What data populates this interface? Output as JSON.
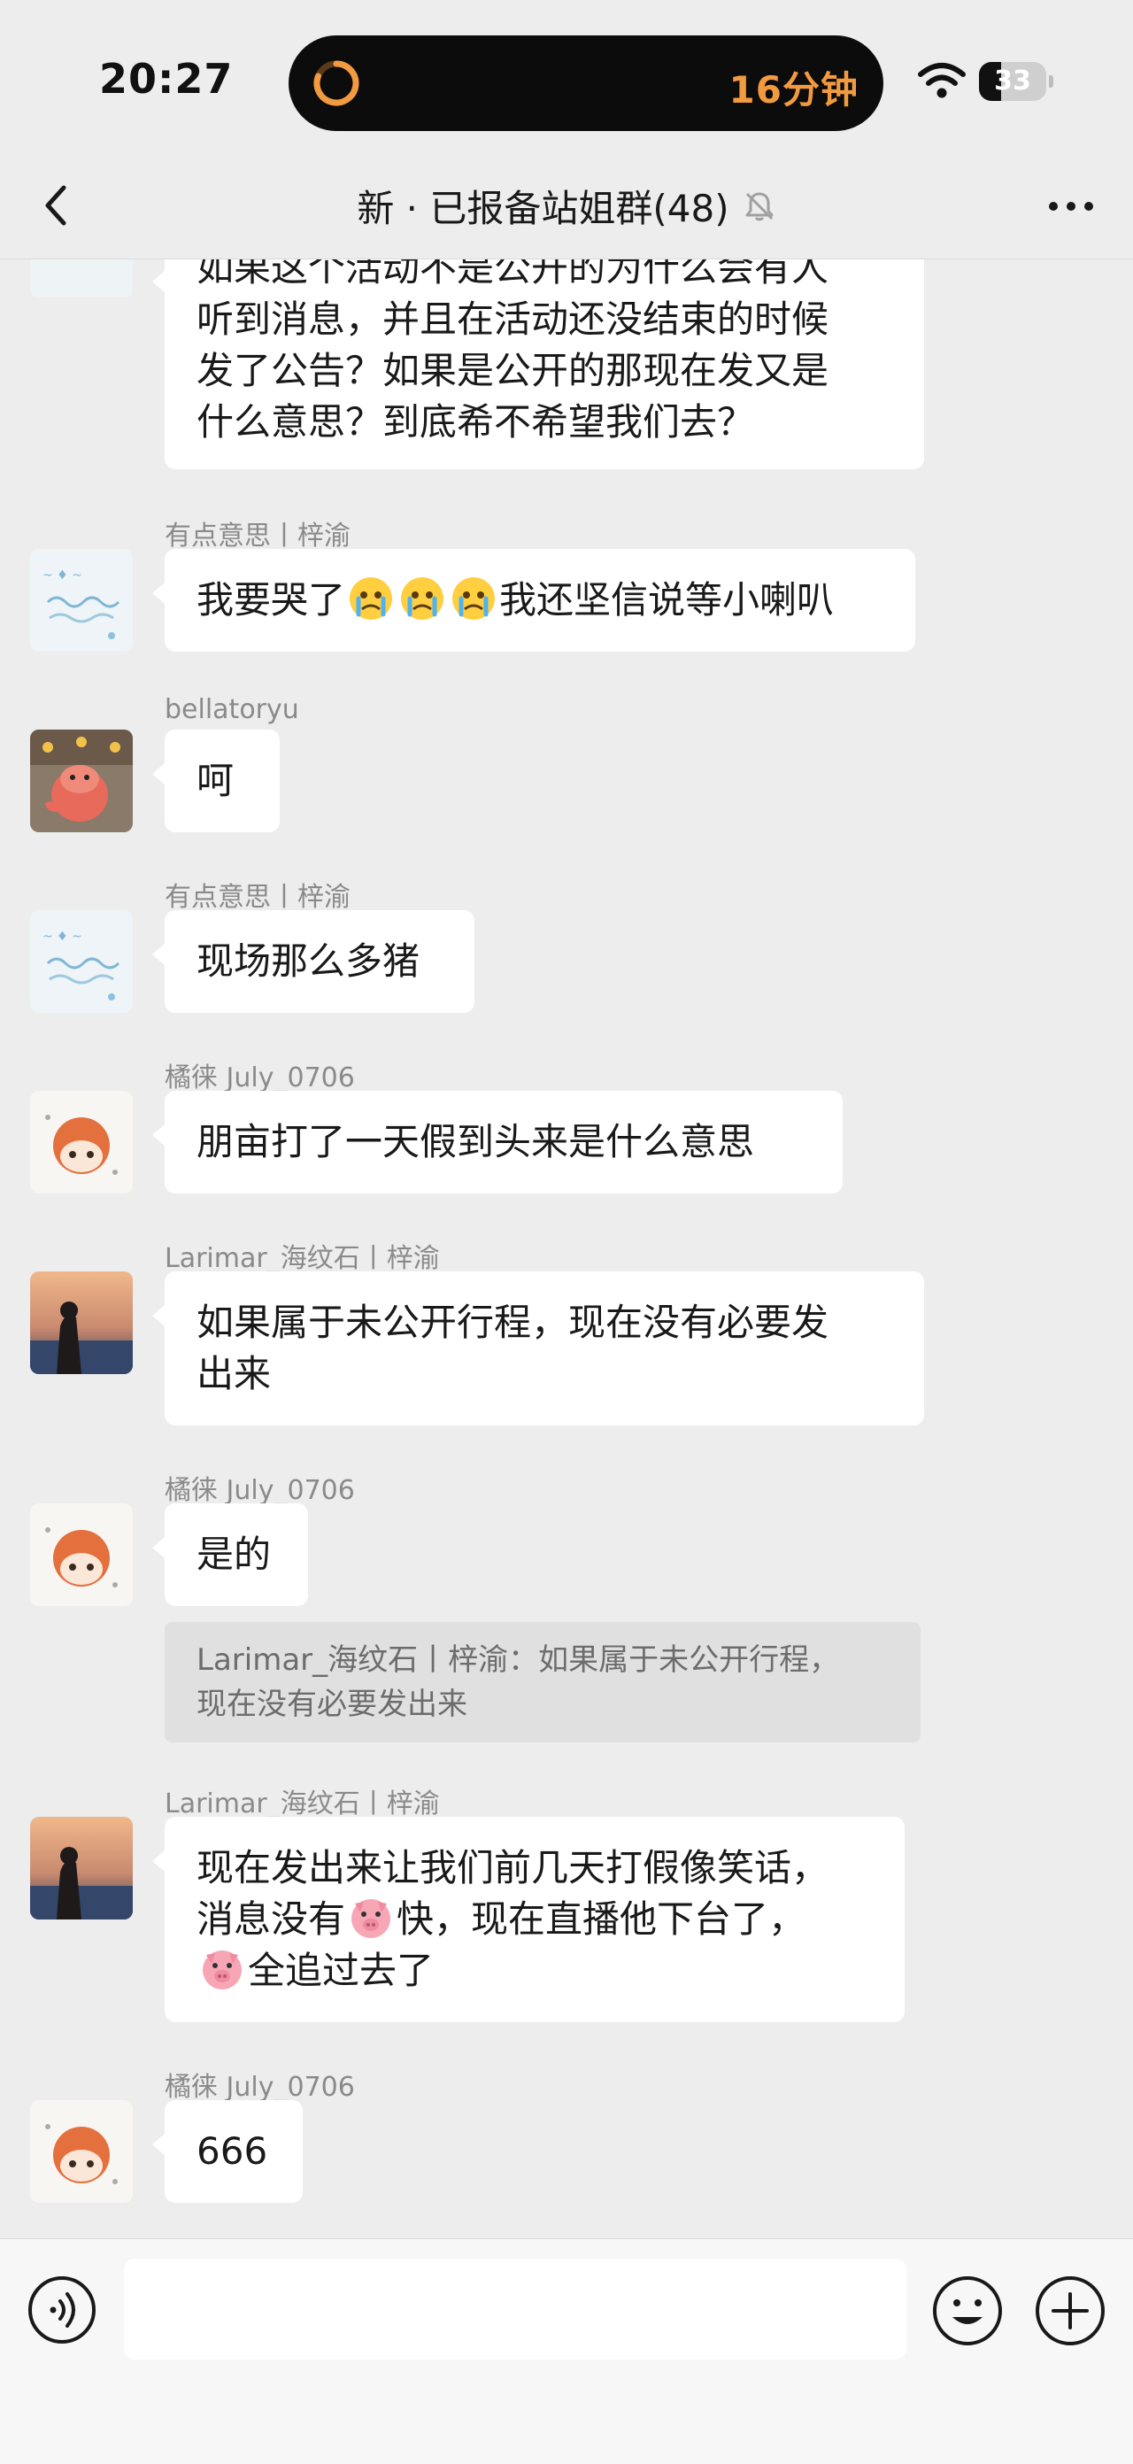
{
  "status_bar": {
    "time": "20:27",
    "activity": "16分钟",
    "battery": "33",
    "battery_level_percent": 33
  },
  "header": {
    "title": "新 · 已报备站姐群(48)"
  },
  "messages": [
    {
      "text": "如果这个活动不是公开的为什么会有人\n听到消息，并且在活动还没结束的时候\n发了公告？如果是公开的那现在发又是\n什么意思？到底希不希望我们去？"
    },
    {
      "sender": "有点意思丨梓渝",
      "text_pre": "我要哭了",
      "text_post": "我还坚信说等小喇叭"
    },
    {
      "sender": "bellatoryu",
      "text": "呵"
    },
    {
      "sender": "有点意思丨梓渝",
      "text": "现场那么多猪"
    },
    {
      "sender": "橘徕 July_0706",
      "text": "朋亩打了一天假到头来是什么意思"
    },
    {
      "sender": "Larimar_海纹石丨梓渝",
      "text": "如果属于未公开行程，现在没有必要发\n出来"
    },
    {
      "sender": "橘徕 July_0706",
      "text": "是的",
      "quote": "Larimar_海纹石丨梓渝：如果属于未公开行程，\n现在没有必要发出来"
    },
    {
      "sender": "Larimar_海纹石丨梓渝",
      "line1": "现在发出来让我们前几天打假像笑话，",
      "line2_pre": "消息没有",
      "line2_post": "快，现在直播他下台了，",
      "line3_post": "全追过去了"
    },
    {
      "sender": "橘徕 July_0706",
      "text": "666"
    }
  ],
  "input": {
    "placeholder": ""
  },
  "icons": {
    "back": "chevron-left-icon",
    "mute": "bell-off-icon",
    "more": "more-dots-icon",
    "voice": "voice-icon",
    "emoji": "emoji-icon",
    "plus": "plus-icon",
    "pig": "pig-face-icon",
    "cry": "crying-face-icon"
  },
  "colors": {
    "background": "#ededed",
    "bubble": "#ffffff",
    "activity_orange": "#f29a3f",
    "quote_bg": "#e0e0e0"
  }
}
